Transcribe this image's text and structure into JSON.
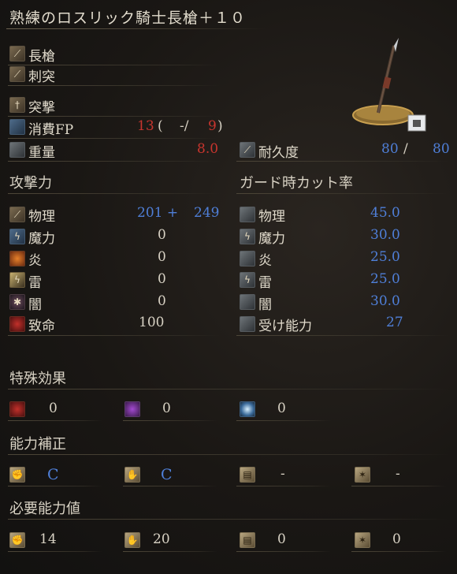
{
  "title": "熟練のロスリック騎士長槍＋１０",
  "info": {
    "weapon_type": "長槍",
    "attack_type": "刺突",
    "skill": "突撃",
    "fp_label": "消費FP",
    "fp_cost": "13",
    "fp_paren_open": "(",
    "fp_mid": "-/",
    "fp_max": "9",
    "fp_paren_close": ")",
    "weight_label": "重量",
    "weight": "8.0",
    "durability_label": "耐久度",
    "durability_cur": "80",
    "durability_sep": "/",
    "durability_max": "80"
  },
  "attack": {
    "heading": "攻撃力",
    "rows": [
      {
        "label": "物理",
        "value": "201 +",
        "extra": "249"
      },
      {
        "label": "魔力",
        "value": "0"
      },
      {
        "label": "炎",
        "value": "0"
      },
      {
        "label": "雷",
        "value": "0"
      },
      {
        "label": "闇",
        "value": "0"
      },
      {
        "label": "致命",
        "value": "100"
      }
    ]
  },
  "guard": {
    "heading": "ガード時カット率",
    "rows": [
      {
        "label": "物理",
        "value": "45.0"
      },
      {
        "label": "魔力",
        "value": "30.0"
      },
      {
        "label": "炎",
        "value": "25.0"
      },
      {
        "label": "雷",
        "value": "25.0"
      },
      {
        "label": "闇",
        "value": "30.0"
      },
      {
        "label": "受け能力",
        "value": "27"
      }
    ]
  },
  "effects": {
    "heading": "特殊効果",
    "values": [
      "0",
      "0",
      "0"
    ]
  },
  "scaling": {
    "heading": "能力補正",
    "values": [
      "C",
      "C",
      "-",
      "-"
    ]
  },
  "requirements": {
    "heading": "必要能力値",
    "values": [
      "14",
      "20",
      "0",
      "0"
    ]
  },
  "icons": [
    "spear-icon",
    "thrust-icon",
    "skill-icon",
    "fp-icon",
    "weight-icon",
    "durability-icon",
    "strength-icon",
    "dexterity-icon",
    "intelligence-icon",
    "faith-icon",
    "bleed-icon",
    "poison-icon",
    "frost-icon"
  ]
}
